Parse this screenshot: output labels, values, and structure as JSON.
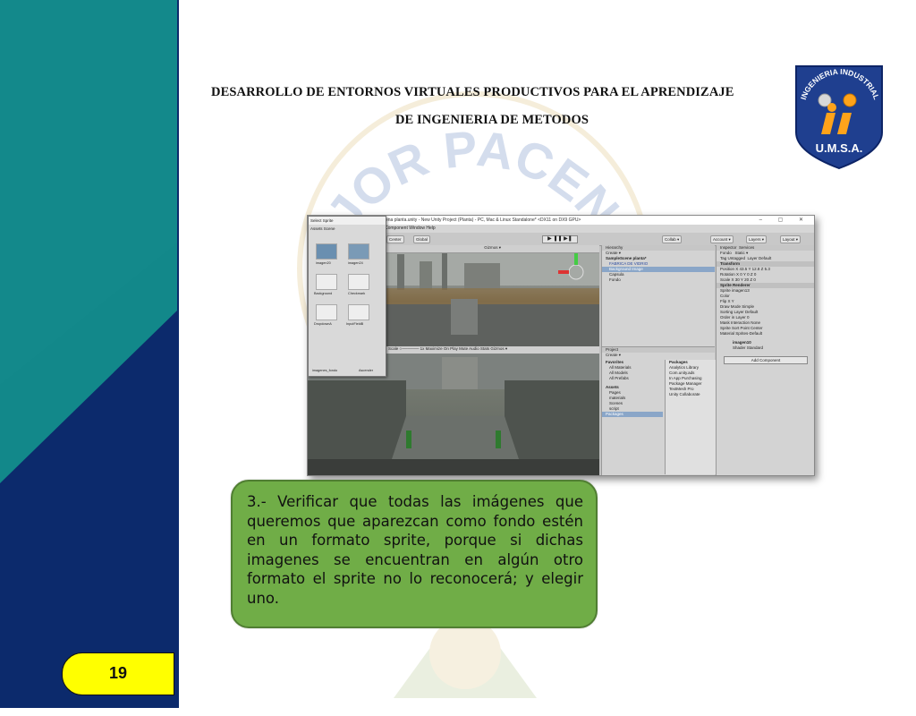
{
  "title": {
    "line1": "DESARROLLO DE ENTORNOS VIRTUALES PRODUCTIVOS PARA EL APRENDIZAJE",
    "line2": "DE INGENIERIA DE METODOS"
  },
  "logo": {
    "arc_text": "INGENIERIA INDUSTRIAL",
    "bottom_text": "U.M.S.A."
  },
  "watermark": {
    "arc_text": "MAJOR PACENSIS"
  },
  "screenshot": {
    "window_title": "scena planta.unity - New Unity Project (Planta) - PC, Mac & Linux Standalone* <DX11 on DX9 GPU>",
    "menu": "Component   Window   Help",
    "window_controls": "– ▢ ✕",
    "toolbar": {
      "center": "Center",
      "global": "Global",
      "play": "▶ ❚❚ ▶❚",
      "collab": "Collab ▾",
      "account": "Account ▾",
      "layers": "Layers ▾",
      "layout": "Layout ▾"
    },
    "sprite_window": {
      "title": "Select Sprite",
      "tabs": "Assets   Scene",
      "items": [
        "imagen20",
        "imagen24",
        "Background",
        "Checkmark",
        "DropdownA",
        "InputFieldB",
        "imagenes_fondo",
        "Ascender"
      ]
    },
    "scene_bar": "Gizmos ▾",
    "game_bar": "Scale ○────── 1x   Maximize On Play  Mute Audio  Stats  Gizmos ▾",
    "hierarchy": {
      "header": "Hierarchy",
      "create": "Create ▾",
      "items": [
        "SampleScene planta*",
        "FABRICA DE VIDRIO",
        "Background Image",
        "Capsula",
        "Fondo"
      ]
    },
    "project": {
      "header": "Project",
      "create": "Create ▾",
      "favorites": [
        "Favorites",
        "All Materials",
        "All Models",
        "All Prefabs"
      ],
      "assets": [
        "Assets",
        "Pages",
        "materials",
        "Scenes",
        "script",
        "Packages"
      ],
      "packages": [
        "Packages",
        "Analytics Library",
        "Com.unity.ads",
        "In App Purchasing",
        "Package Manager",
        "TextMesh Pro",
        "Unity Collaborate"
      ]
    },
    "inspector": {
      "header": "Inspector",
      "services": "Services",
      "object": "Fondo",
      "static": "Static ▾",
      "tag": "Tag  Untagged",
      "layer": "Layer  Default",
      "transform": "Transform",
      "position": "Position  X 43.5  Y 12.8  Z 5.3",
      "rotation": "Rotation  X 0  Y 0  Z 0",
      "scale": "Scale  X 30  Y 20  Z 0",
      "sprite_renderer": "Sprite Renderer",
      "fields": [
        "Sprite  imagen13",
        "Color",
        "Flip  X  Y",
        "Draw Mode  Simple",
        "Sorting Layer  Default",
        "Order in Layer  0",
        "Mask Interaction  None",
        "Sprite Sort Point  Center",
        "Material  Sprites-Default"
      ],
      "material": "imagen10",
      "shader": "Shader  Standard",
      "add_component": "Add Component"
    }
  },
  "callout": {
    "text": "3.- Verificar que todas las imágenes que queremos que aparezcan como fondo estén en un formato sprite, porque si dichas imagenes se encuentran en algún otro formato el sprite no lo reconocerá; y elegir uno."
  },
  "page": {
    "number": "19"
  },
  "colors": {
    "teal": "#12888a",
    "navy": "#0c2a6c",
    "callout_green": "#70ad47",
    "page_yellow": "#ffff00"
  }
}
